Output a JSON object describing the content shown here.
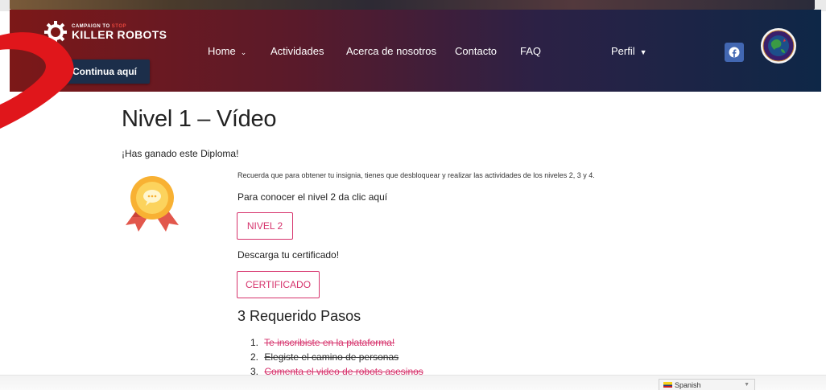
{
  "header": {
    "logo": {
      "line1_prefix": "CAMPAIGN TO ",
      "line1_highlight": "STOP",
      "line2": "KILLER ROBOTS"
    },
    "nav": {
      "home": "Home",
      "actividades": "Actividades",
      "acerca": "Acerca de nosotros",
      "contacto": "Contacto",
      "faq": "FAQ",
      "perfil": "Perfil"
    },
    "continua_label": "Continua aquí"
  },
  "main": {
    "title": "Nivel 1 – Vídeo",
    "diploma_message": "¡Has ganado este Diploma!",
    "reminder": "Recuerda que para obtener tu insignia, tienes que desbloquear y realizar las actividades de los niveles 2, 3 y 4.",
    "level_hint": "Para conocer el nivel 2 da clic aquí",
    "level_button": "NIVEL 2",
    "download_hint": "Descarga tu certificado!",
    "certificate_button": "CERTIFICADO",
    "steps_title": "3 Requerido Pasos",
    "steps": [
      {
        "num": "1.",
        "text": "Te inscribiste en la plataforma!"
      },
      {
        "num": "2.",
        "text": "Elegiste el camino de personas"
      },
      {
        "num": "3.",
        "text": "Comenta el video de robots asesinos"
      }
    ]
  },
  "language_selector": {
    "value": "Spanish"
  },
  "colors": {
    "accent_pink": "#d6336c",
    "header_left": "#7c1818",
    "header_right": "#0e2747",
    "button_dark": "#1c2e4a",
    "facebook": "#4267b2"
  },
  "icons": [
    "gear-logo-icon",
    "chevron-down-icon",
    "facebook-icon",
    "scout-seal-icon",
    "medal-icon"
  ]
}
